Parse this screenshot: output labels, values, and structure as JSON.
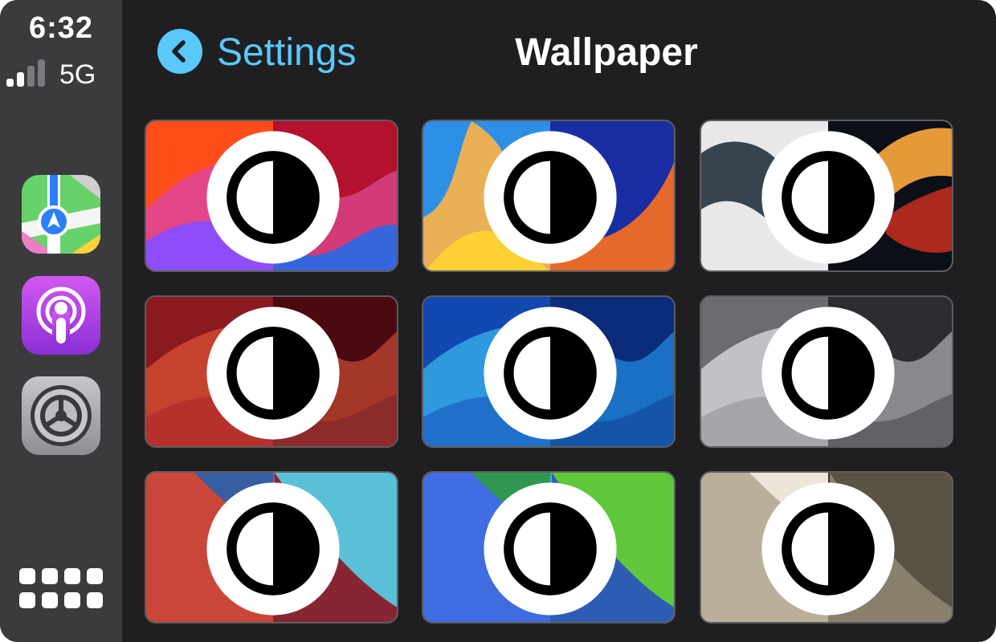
{
  "status": {
    "time": "6:32",
    "network": "5G",
    "signal_bars_filled": 2,
    "signal_bars_total": 4
  },
  "sidebar": {
    "apps": [
      {
        "name": "Maps",
        "icon": "maps-icon"
      },
      {
        "name": "Podcasts",
        "icon": "podcasts-icon"
      },
      {
        "name": "Settings",
        "icon": "settings-gear-icon"
      }
    ],
    "home_grid_icon": "app-grid-icon"
  },
  "header": {
    "back_label": "Settings",
    "title": "Wallpaper"
  },
  "colors": {
    "accent": "#5ac8fa",
    "background": "#1f1f22",
    "sidebar": "#3b3b3e"
  },
  "wallpapers": [
    {
      "style": "Magenta Wave",
      "light": [
        "#ff4d1a",
        "#e0468d",
        "#8a4dff"
      ],
      "dark": [
        "#b3112e",
        "#d33f7c",
        "#2e67e0"
      ]
    },
    {
      "style": "Blue Swirl",
      "light": [
        "#2e8fe6",
        "#f3b24e",
        "#ffd232"
      ],
      "dark": [
        "#1a2ea3",
        "#f06d25",
        "#2d3ab8"
      ]
    },
    {
      "style": "Blob",
      "light": [
        "#e8e8ea",
        "#2e3a48",
        "#5a8c9c"
      ],
      "dark": [
        "#0b0f18",
        "#f2a13a",
        "#b52b1d"
      ]
    },
    {
      "style": "Red Wave",
      "light": [
        "#8a1a20",
        "#c8452e",
        "#b5302c"
      ],
      "dark": [
        "#4a0a10",
        "#a83a2a",
        "#8a2a2a"
      ]
    },
    {
      "style": "Blue Wave",
      "light": [
        "#1348b0",
        "#2f9ee0",
        "#1e6ec8"
      ],
      "dark": [
        "#0b2c78",
        "#1d74c8",
        "#1553a8"
      ]
    },
    {
      "style": "Gray Wave",
      "light": [
        "#6a6c70",
        "#c5c7ca",
        "#a2a4a8"
      ],
      "dark": [
        "#2b2d30",
        "#8c8e92",
        "#5e6064"
      ]
    },
    {
      "style": "Coral Drift",
      "light": [
        "#e06a50",
        "#c84538",
        "#2e5fa8"
      ],
      "dark": [
        "#5ac0d8",
        "#8a1e2a",
        "#c04a6e"
      ]
    },
    {
      "style": "Violet Drift",
      "light": [
        "#5a4ed0",
        "#3e6ee0",
        "#2e9a4a"
      ],
      "dark": [
        "#5ec83a",
        "#2a56b8",
        "#3bb0e0"
      ]
    },
    {
      "style": "Sand Drift",
      "light": [
        "#d8cebc",
        "#b8ad98",
        "#efe8da"
      ],
      "dark": [
        "#5a5242",
        "#8c8270",
        "#3c3628"
      ]
    }
  ]
}
